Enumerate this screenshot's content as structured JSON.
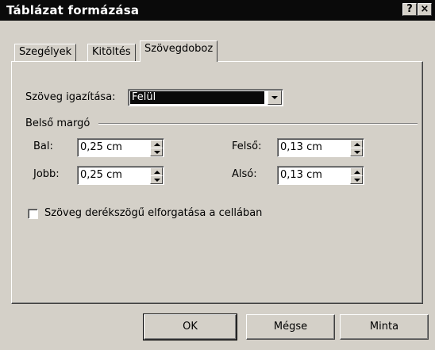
{
  "window": {
    "title": "Táblázat formázása",
    "help_label": "?",
    "close_label": "×"
  },
  "tabs": [
    {
      "label": "Szegélyek",
      "active": false
    },
    {
      "label": "Kitöltés",
      "active": false
    },
    {
      "label": "Szövegdoboz",
      "active": true
    }
  ],
  "alignment": {
    "label": "Szöveg igazítása:",
    "value": "Felül"
  },
  "margin_group": {
    "title": "Belső margó",
    "left": {
      "label": "Bal:",
      "value": "0,25 cm"
    },
    "right": {
      "label": "Jobb:",
      "value": "0,25 cm"
    },
    "top": {
      "label": "Felső:",
      "value": "0,13 cm"
    },
    "bottom": {
      "label": "Alsó:",
      "value": "0,13 cm"
    }
  },
  "rotate_checkbox": {
    "label": "Szöveg derékszögű elforgatása a cellában",
    "checked": false
  },
  "buttons": {
    "ok": "OK",
    "cancel": "Mégse",
    "preview": "Minta"
  }
}
